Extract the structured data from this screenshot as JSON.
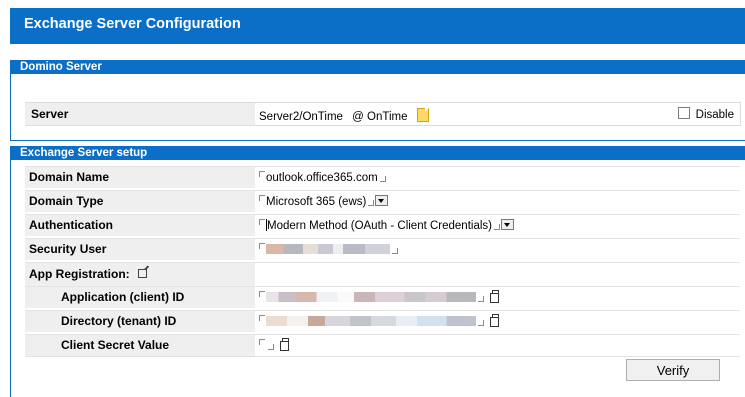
{
  "header": {
    "title": "Exchange Server Configuration"
  },
  "domino": {
    "title": "Domino Server",
    "server_label": "Server",
    "server_value": "Server2/OnTime",
    "server_suffix": "@ OnTime",
    "disable_label": "Disable"
  },
  "exchange": {
    "title": "Exchange Server setup",
    "domain_name_label": "Domain Name",
    "domain_name_value": "outlook.office365.com",
    "domain_type_label": "Domain Type",
    "domain_type_value": "Microsoft 365 (ews)",
    "authentication_label": "Authentication",
    "authentication_value": "Modern Method (OAuth - Client Credentials)",
    "security_user_label": "Security User",
    "app_registration_label": "App Registration:",
    "app_id_label": "Application (client) ID",
    "tenant_id_label": "Directory (tenant) ID",
    "client_secret_label": "Client Secret Value"
  },
  "buttons": {
    "verify": "Verify"
  },
  "colors": {
    "accent": "#0b6fc7",
    "label_bg": "#efefef"
  },
  "icons": {
    "note": "note-icon",
    "copy": "copy-icon",
    "external": "external-link-icon",
    "dropdown": "dropdown-arrow-icon"
  }
}
